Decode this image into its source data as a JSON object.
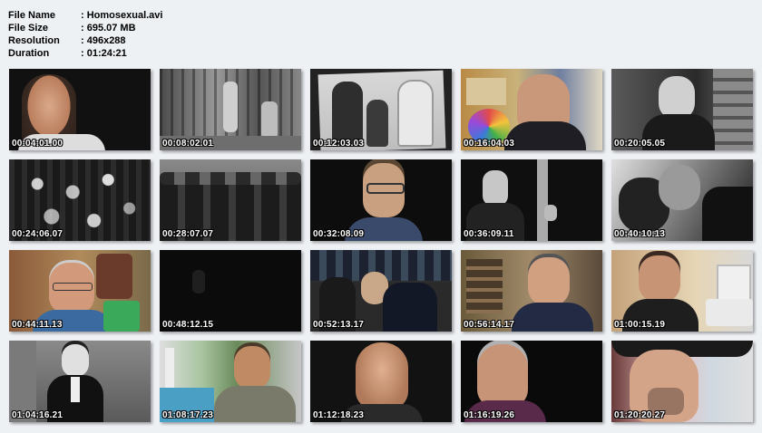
{
  "info": {
    "file_name_label": "File Name",
    "file_name_value": ": Homosexual.avi",
    "file_size_label": "File Size",
    "file_size_value": ": 695.07 MB",
    "resolution_label": "Resolution",
    "resolution_value": ": 496x288",
    "duration_label": "Duration",
    "duration_value": ": 01:24:21"
  },
  "thumbnails": [
    {
      "time": "00:04:01.00"
    },
    {
      "time": "00:08:02.01"
    },
    {
      "time": "00:12:03.03"
    },
    {
      "time": "00:16:04.03"
    },
    {
      "time": "00:20:05.05"
    },
    {
      "time": "00:24:06.07"
    },
    {
      "time": "00:28:07.07"
    },
    {
      "time": "00:32:08.09"
    },
    {
      "time": "00:36:09.11"
    },
    {
      "time": "00:40:10.13"
    },
    {
      "time": "00:44:11.13"
    },
    {
      "time": "00:48:12.15"
    },
    {
      "time": "00:52:13.17"
    },
    {
      "time": "00:56:14.17"
    },
    {
      "time": "01:00:15.19"
    },
    {
      "time": "01:04:16.21"
    },
    {
      "time": "01:08:17.23"
    },
    {
      "time": "01:12:18.23"
    },
    {
      "time": "01:16:19.26"
    },
    {
      "time": "01:20:20.27"
    }
  ]
}
